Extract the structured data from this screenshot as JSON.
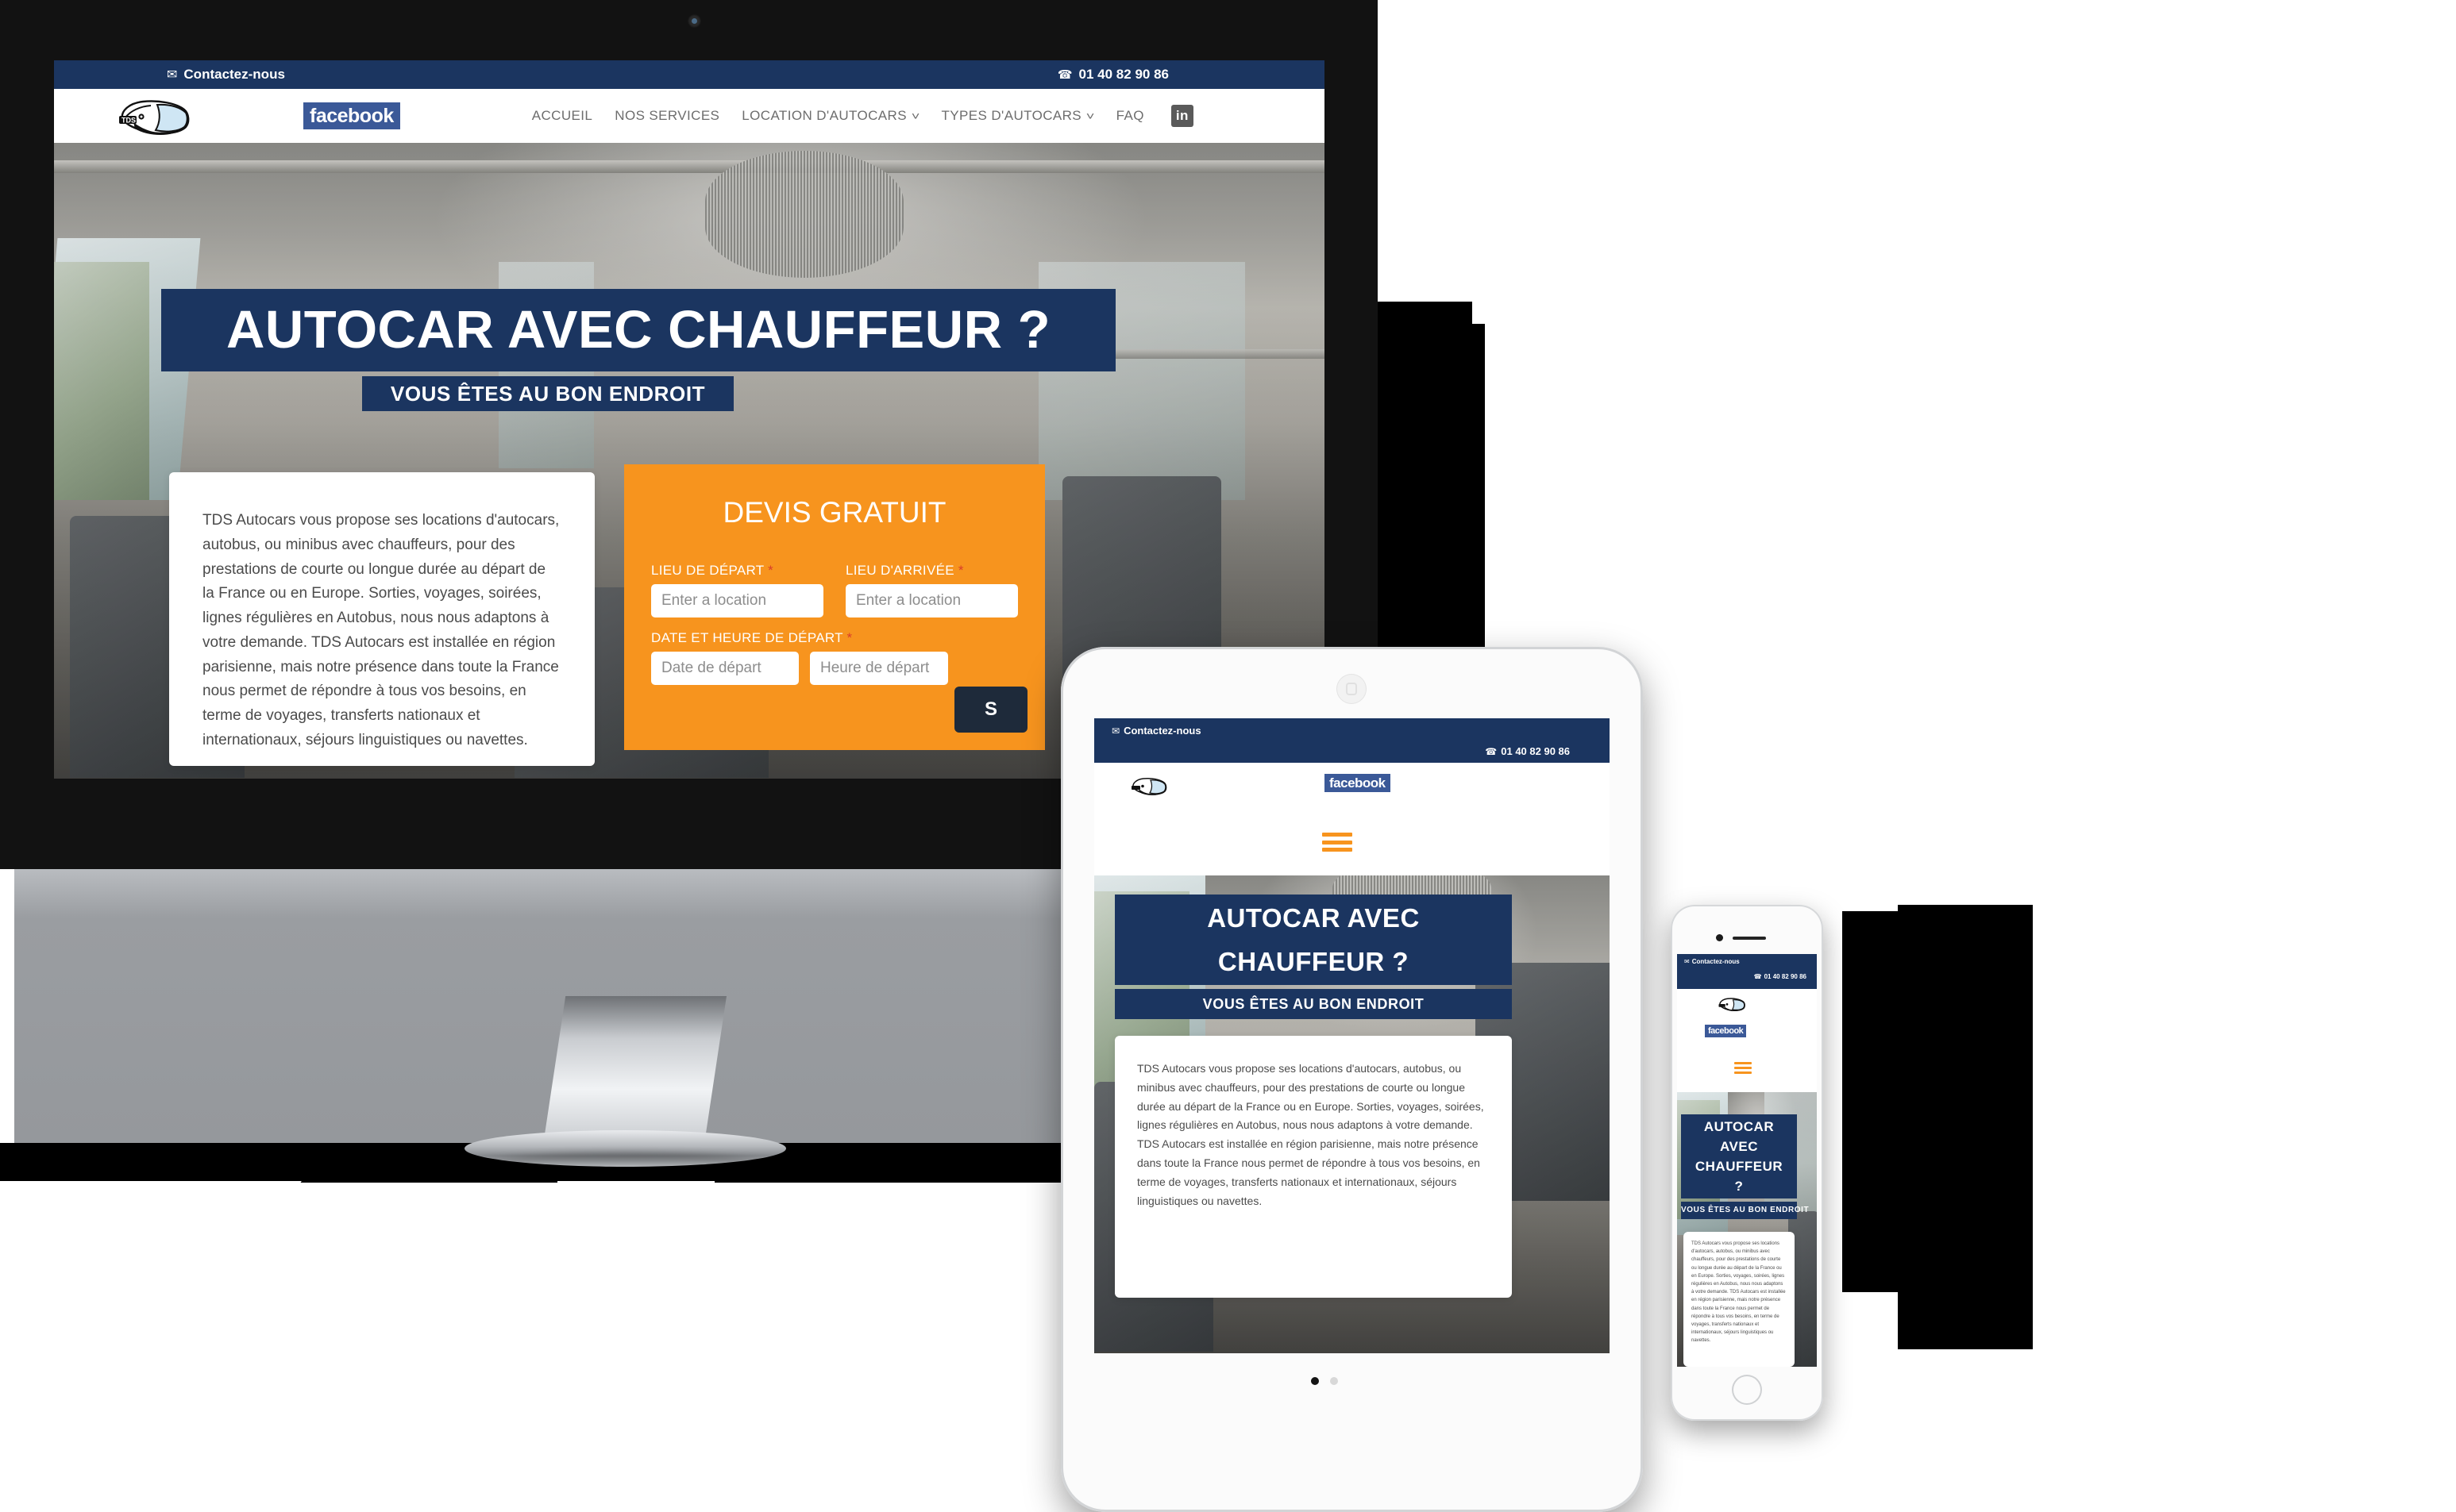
{
  "brand": {
    "logo_alt": "TDS Autocars",
    "accent_orange": "#f7941e",
    "navy": "#1b3560",
    "facebook_blue": "#3b5998"
  },
  "topbar": {
    "contact_label": "Contactez-nous",
    "mail_icon": "envelope-icon",
    "phone_icon": "phone-icon",
    "phone": "01 40 82 90 86"
  },
  "header": {
    "facebook_label": "facebook",
    "linkedin_label": "in",
    "nav": [
      {
        "label": "ACCUEIL",
        "has_dropdown": false
      },
      {
        "label": "NOS SERVICES",
        "has_dropdown": false
      },
      {
        "label": "LOCATION D'AUTOCARS",
        "has_dropdown": true
      },
      {
        "label": "TYPES D'AUTOCARS",
        "has_dropdown": true
      },
      {
        "label": "FAQ",
        "has_dropdown": false
      }
    ],
    "chevron": "˅",
    "burger_icon": "hamburger-menu-icon"
  },
  "hero": {
    "title": "AUTOCAR AVEC CHAUFFEUR ?",
    "title_line1": "AUTOCAR AVEC",
    "title_line2": "CHAUFFEUR ?",
    "title_m1": "AUTOCAR",
    "title_m2": "AVEC",
    "title_m3": "CHAUFFEUR",
    "title_m4": "?",
    "subtitle": "VOUS ÊTES AU BON ENDROIT"
  },
  "intro": {
    "paragraph": "TDS Autocars vous propose ses locations d'autocars, autobus, ou minibus avec chauffeurs, pour des prestations de courte ou longue durée au départ de la France ou en Europe. Sorties, voyages, soirées, lignes régulières en Autobus, nous nous adaptons à votre demande. TDS Autocars est installée en région parisienne, mais notre présence dans toute la France nous permet de répondre à tous vos besoins, en terme de voyages, transferts nationaux et internationaux, séjours linguistiques ou navettes."
  },
  "quote_form": {
    "title": "DEVIS GRATUIT",
    "required_mark": "*",
    "fields": [
      {
        "label": "LIEU DE DÉPART",
        "placeholder": "Enter a location",
        "required": true
      },
      {
        "label": "LIEU D'ARRIVÉE",
        "placeholder": "Enter a location",
        "required": true
      }
    ],
    "datetime_label": "DATE ET HEURE DE DÉPART",
    "date_placeholder": "Date de départ",
    "time_placeholder": "Heure de départ",
    "submit_label": "S"
  },
  "devices": {
    "desktop_name": "desktop-monitor",
    "tablet_name": "tablet-device",
    "phone_name": "phone-device",
    "carousel_dots": 2,
    "carousel_active": 0
  }
}
